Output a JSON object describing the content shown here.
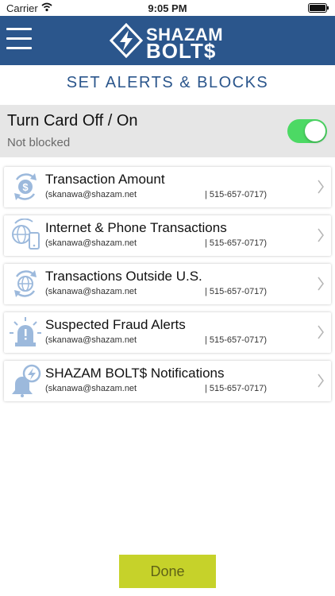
{
  "status_bar": {
    "carrier": "Carrier",
    "time": "9:05 PM"
  },
  "navbar": {
    "menu_icon": "hamburger-menu-icon",
    "logo": {
      "top": "SHAZAM",
      "bottom": "BOLT$",
      "mark_icon": "bolt-logo-icon"
    }
  },
  "page": {
    "title": "SET ALERTS & BLOCKS"
  },
  "card_toggle": {
    "title": "Turn Card Off / On",
    "status": "Not blocked",
    "on": true,
    "color_on": "#4cd964"
  },
  "alerts": [
    {
      "icon": "dollar-sync-icon",
      "title": "Transaction Amount",
      "email": "(skanawa@shazam.net",
      "phone": "| 515-657-0717)"
    },
    {
      "icon": "globe-phone-icon",
      "title": "Internet & Phone Transactions",
      "email": "(skanawa@shazam.net",
      "phone": "| 515-657-0717)"
    },
    {
      "icon": "globe-sync-icon",
      "title": "Transactions Outside U.S.",
      "email": "(skanawa@shazam.net",
      "phone": "| 515-657-0717)"
    },
    {
      "icon": "alarm-light-icon",
      "title": "Suspected Fraud Alerts",
      "email": "(skanawa@shazam.net",
      "phone": "| 515-657-0717)"
    },
    {
      "icon": "bell-bolt-icon",
      "title": "SHAZAM BOLT$ Notifications",
      "email": "(skanawa@shazam.net",
      "phone": "| 515-657-0717)"
    }
  ],
  "done_button": {
    "label": "Done"
  },
  "colors": {
    "nav": "#2b568c",
    "accent": "#c6d22a",
    "icon": "#9cb9dc"
  }
}
